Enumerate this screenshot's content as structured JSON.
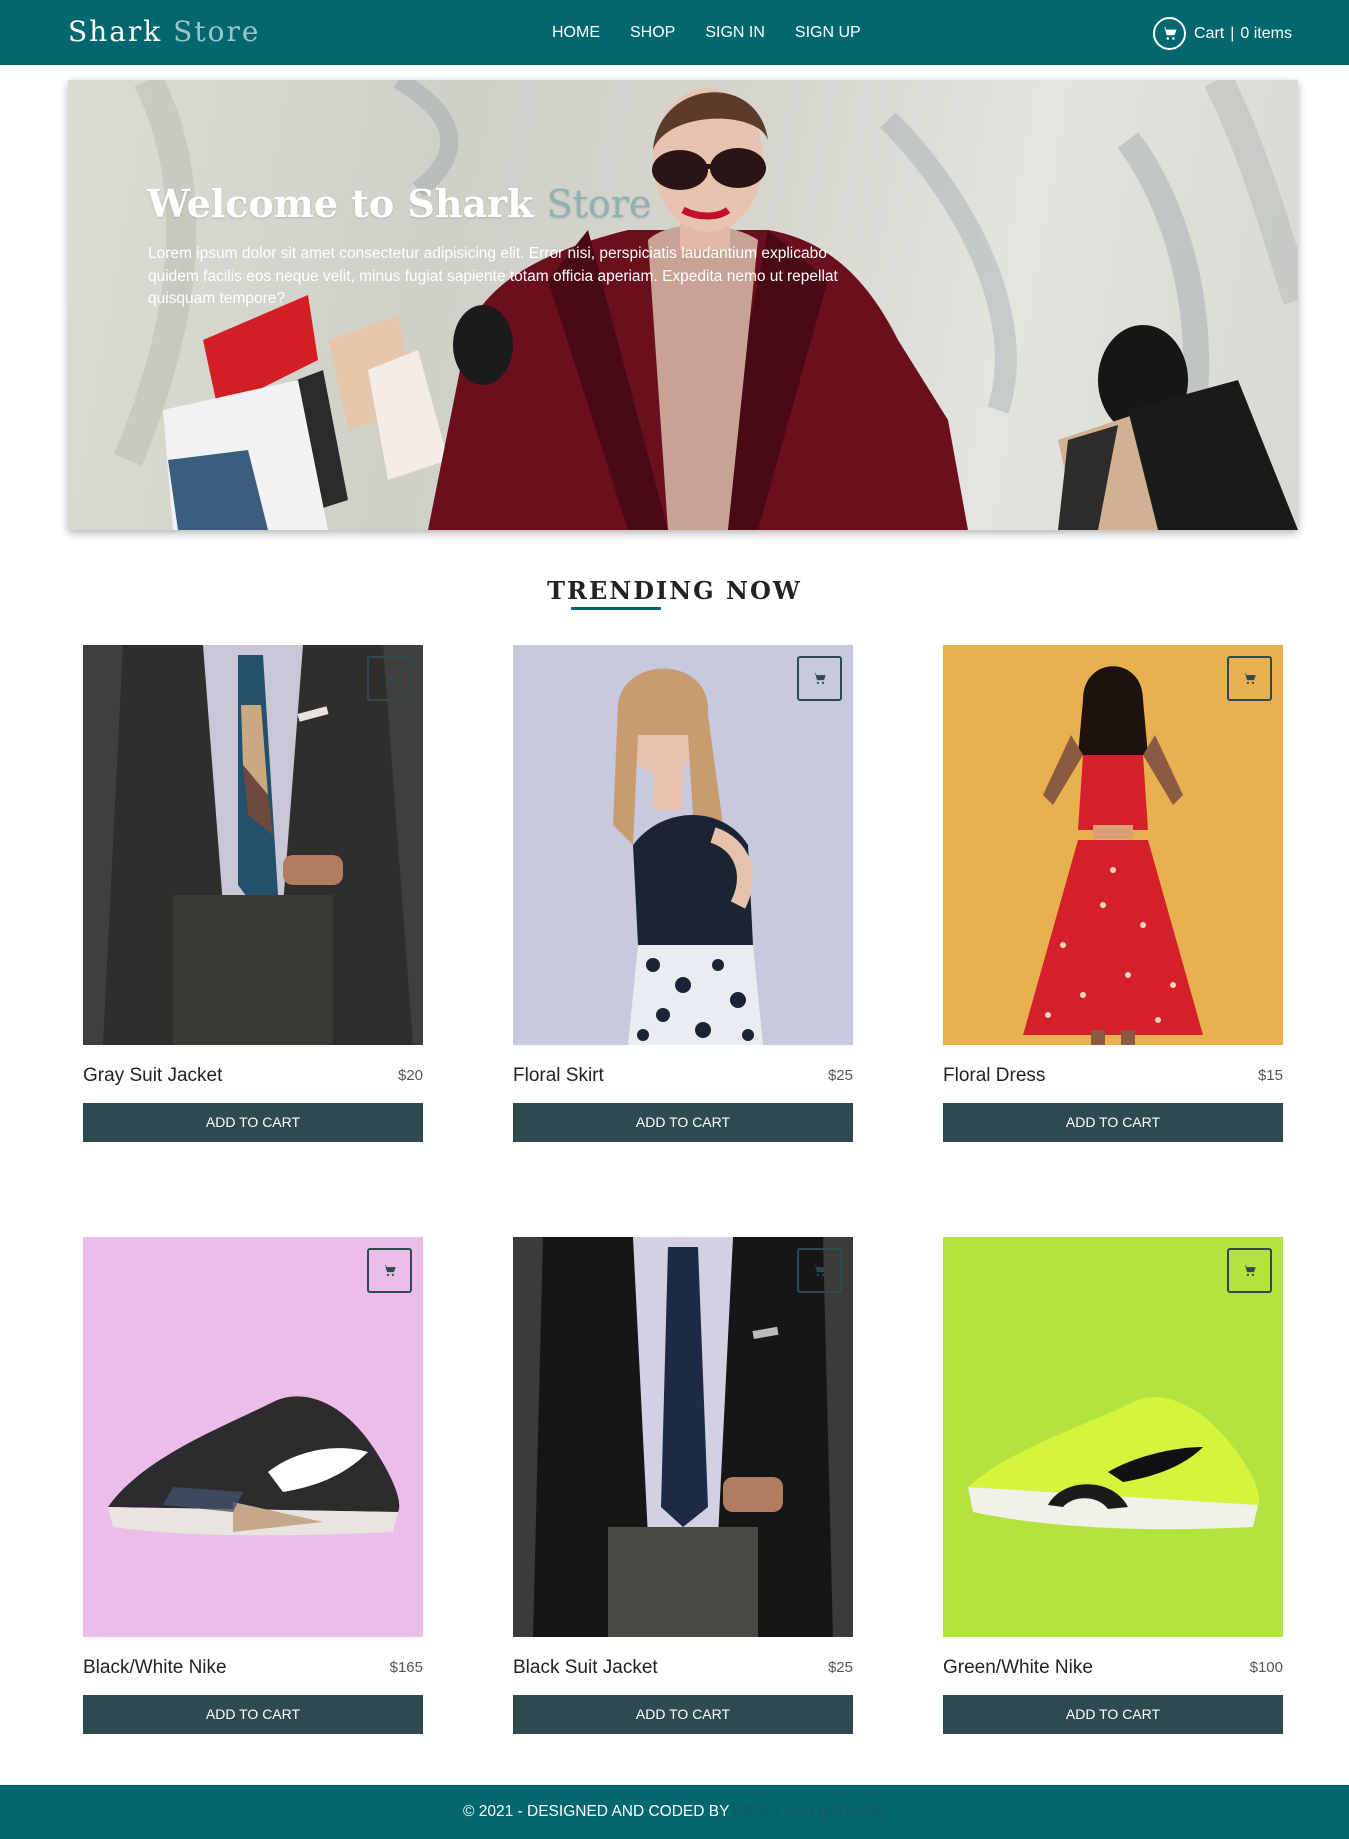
{
  "navbar": {
    "brand_part1": "Shark",
    "brand_part2": "Store",
    "links": [
      "HOME",
      "SHOP",
      "SIGN IN",
      "SIGN UP"
    ],
    "cart_label": "Cart",
    "cart_separator": "|",
    "cart_count": "0 items",
    "cart_icon": "shopping-cart-icon"
  },
  "hero": {
    "title_part1": "Welcome to Shark",
    "title_part2": "Store",
    "text": "Lorem ipsum dolor sit amet consectetur adipisicing elit. Error nisi, perspiciatis laudantium explicabo quidem facilis eos neque velit, minus fugiat sapiente totam officia aperiam. Expedita nemo ut repellat quisquam tempore?"
  },
  "trending": {
    "title": "TRENDING NOW"
  },
  "products": [
    {
      "name": "Gray Suit Jacket",
      "price": "$20",
      "button": "ADD TO CART",
      "bg": "#3f3f3d"
    },
    {
      "name": "Floral Skirt",
      "price": "$25",
      "button": "ADD TO CART",
      "bg": "#c5c9de"
    },
    {
      "name": "Floral Dress",
      "price": "$15",
      "button": "ADD TO CART",
      "bg": "#e9b050"
    },
    {
      "name": "Black/White Nike",
      "price": "$165",
      "button": "ADD TO CART",
      "bg": "#ecbde9"
    },
    {
      "name": "Black Suit Jacket",
      "price": "$25",
      "button": "ADD TO CART",
      "bg": "#3c3b39"
    },
    {
      "name": "Green/White Nike",
      "price": "$100",
      "button": "ADD TO CART",
      "bg": "#b2e33f"
    }
  ],
  "footer": {
    "text": "© 2021 - DESIGNED AND CODED BY",
    "author": "ABDELLAH BAHSINE"
  },
  "colors": {
    "primary": "#03676f",
    "button": "#2f4a4f",
    "brand_accent": "#9fc4c7"
  }
}
